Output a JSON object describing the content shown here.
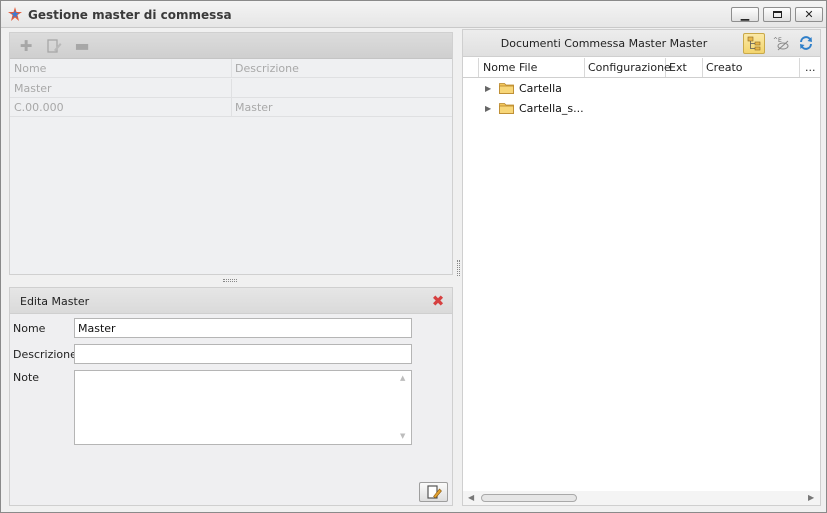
{
  "window": {
    "title": "Gestione master di commessa",
    "minimize_icon": "minimize-icon",
    "maximize_icon": "maximize-icon",
    "close_icon": "close-icon"
  },
  "master_list": {
    "toolbar_icons": [
      "add-icon",
      "edit-icon",
      "remove-icon"
    ],
    "columns": [
      "Nome",
      "Descrizione"
    ],
    "rows": [
      {
        "nome": "Master",
        "descrizione": ""
      },
      {
        "nome": "C.00.000",
        "descrizione": "Master"
      }
    ]
  },
  "edit_master": {
    "title": "Edita Master",
    "nome_label": "Nome",
    "nome_value": "Master",
    "descrizione_label": "Descrizione",
    "descrizione_value": "",
    "note_label": "Note",
    "note_value": ""
  },
  "documents": {
    "title": "Documenti Commessa Master Master",
    "columns": [
      "Nome File",
      "Configurazione",
      "Ext",
      "Creato",
      "..."
    ],
    "items": [
      {
        "name": "Cartella"
      },
      {
        "name": "Cartella_s..."
      }
    ]
  },
  "colors": {
    "accent_active": "#f3d56e",
    "close_red": "#d64040",
    "folder": "#e8b84a"
  }
}
